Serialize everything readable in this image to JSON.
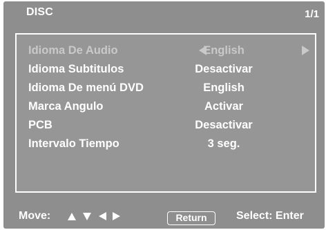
{
  "header": {
    "title": "DISC",
    "page": "1/1"
  },
  "menu": {
    "items": [
      {
        "label": "Idioma De Audio",
        "value": "English",
        "selected": true
      },
      {
        "label": "Idioma Subtitulos",
        "value": "Desactivar",
        "selected": false
      },
      {
        "label": "Idioma De menú DVD",
        "value": "English",
        "selected": false
      },
      {
        "label": "Marca Angulo",
        "value": "Activar",
        "selected": false
      },
      {
        "label": "PCB",
        "value": "Desactivar",
        "selected": false
      },
      {
        "label": "Intervalo Tiempo",
        "value": "3 seg.",
        "selected": false
      }
    ]
  },
  "footer": {
    "move_label": "Move:",
    "return_label": "Return",
    "select_label": "Select: Enter"
  },
  "icons": {
    "move": [
      "up-arrow-icon",
      "down-arrow-icon",
      "left-arrow-icon",
      "right-arrow-icon"
    ],
    "value_cycle": [
      "left-triangle-icon",
      "right-triangle-icon"
    ]
  },
  "colors": {
    "background": "#8e8e8e",
    "text": "#ffffff",
    "dim_text": "#c9c9c9",
    "panel_border": "#ffffff"
  }
}
